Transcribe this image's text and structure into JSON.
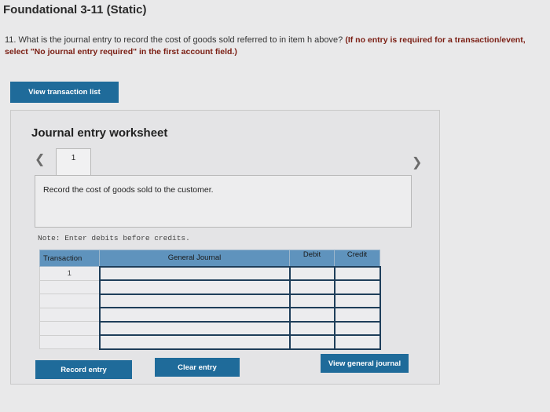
{
  "page": {
    "title": "Foundational 3-11 (Static)",
    "question_text": "11. What is the journal entry to record the cost of goods sold referred to in item h above?",
    "question_instruction": "(If no entry is required for a transaction/event, select \"No journal entry required\" in the first account field.)"
  },
  "buttons": {
    "view_transaction_list": "View transaction list",
    "record_entry": "Record entry",
    "clear_entry": "Clear entry",
    "view_general_journal": "View general journal"
  },
  "worksheet": {
    "title": "Journal entry worksheet",
    "tab_number": "1",
    "description": "Record the cost of goods sold to the customer.",
    "note": "Note: Enter debits before credits.",
    "columns": [
      "Transaction",
      "General Journal",
      "Debit",
      "Credit"
    ],
    "rows": [
      {
        "transaction": "1",
        "account": "",
        "debit": "",
        "credit": ""
      },
      {
        "transaction": "",
        "account": "",
        "debit": "",
        "credit": ""
      },
      {
        "transaction": "",
        "account": "",
        "debit": "",
        "credit": ""
      },
      {
        "transaction": "",
        "account": "",
        "debit": "",
        "credit": ""
      },
      {
        "transaction": "",
        "account": "",
        "debit": "",
        "credit": ""
      },
      {
        "transaction": "",
        "account": "",
        "debit": "",
        "credit": ""
      }
    ]
  }
}
